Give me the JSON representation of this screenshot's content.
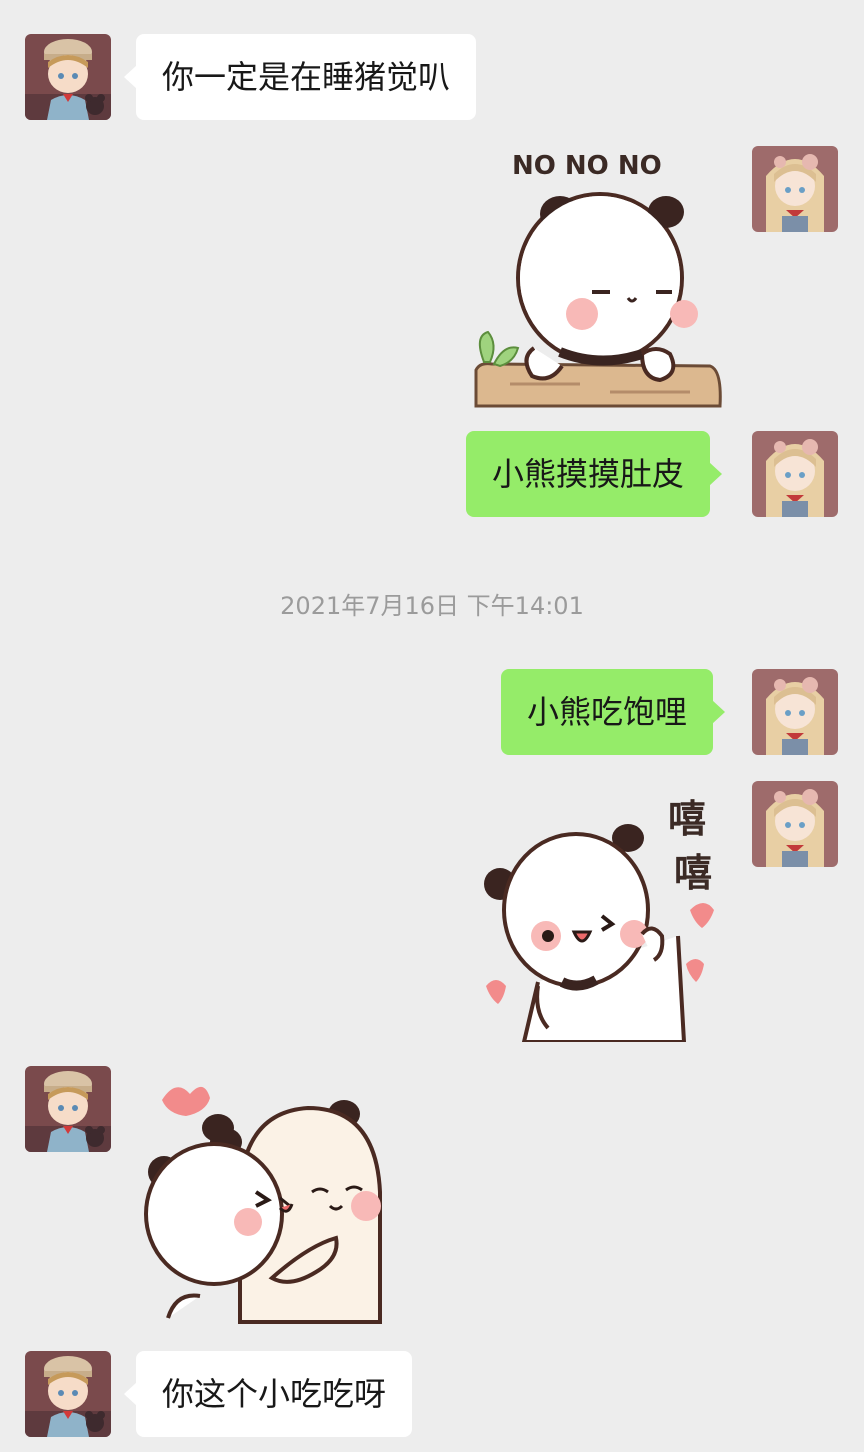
{
  "messages": {
    "m1": {
      "text": "你一定是在睡猪觉叭"
    },
    "m2": {
      "sticker_text": "NO NO NO"
    },
    "m3": {
      "text": "小熊摸摸肚皮"
    },
    "timestamp": "2021年7月16日 下午14:01",
    "m4": {
      "text": "小熊吃饱哩"
    },
    "m5": {
      "sticker_text": "嘻嘻"
    },
    "m7": {
      "text": "你这个小吃吃呀"
    }
  },
  "colors": {
    "background": "#ededed",
    "incoming_bubble": "#ffffff",
    "outgoing_bubble": "#95ec69",
    "timestamp_text": "#9b9b9b"
  },
  "icons": {
    "contact_avatar": "boy-with-hat-avatar",
    "self_avatar": "girl-long-hair-avatar"
  }
}
